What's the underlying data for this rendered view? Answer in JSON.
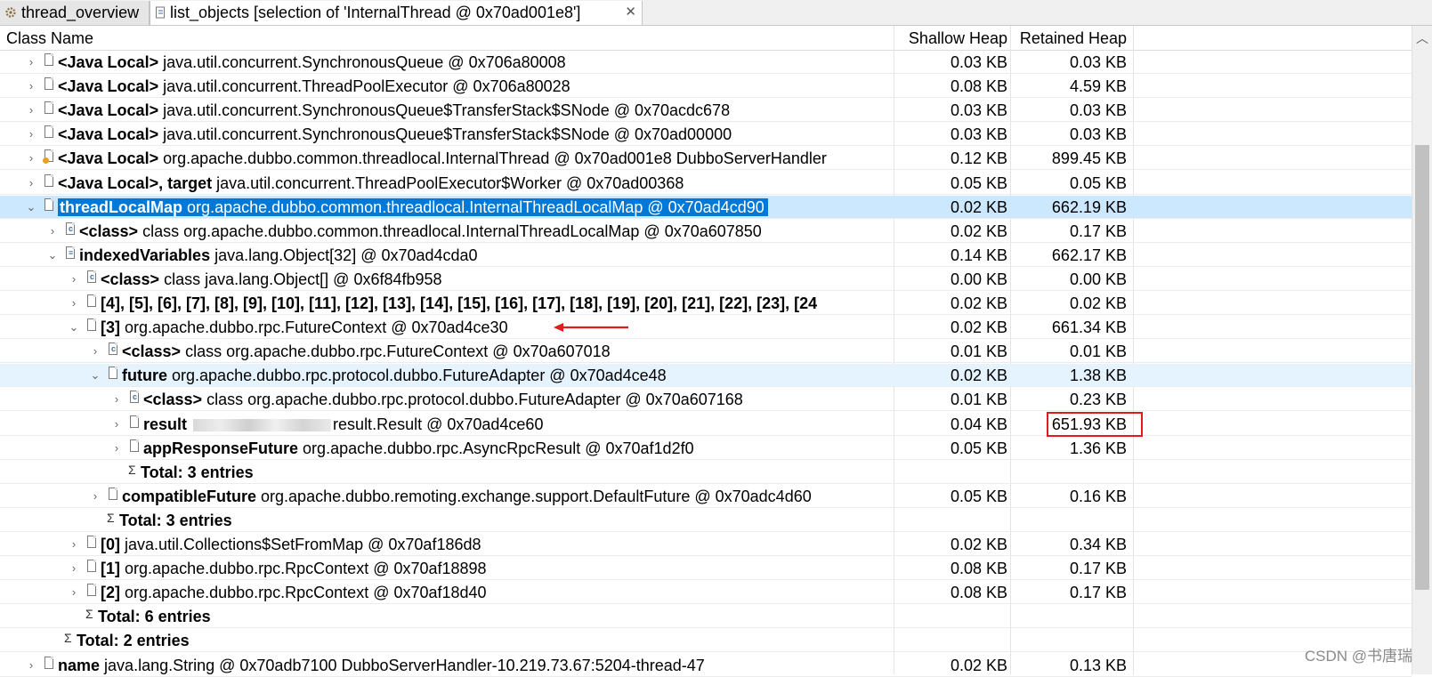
{
  "tabs": [
    {
      "label": "thread_overview",
      "icon": "gear-icon"
    },
    {
      "label": "list_objects  [selection of 'InternalThread @ 0x70ad001e8']",
      "icon": "list-objects-icon",
      "close": "✕"
    }
  ],
  "columns": {
    "name": "Class Name",
    "shallow": "Shallow Heap",
    "retained": "Retained Heap"
  },
  "rows": [
    {
      "depth": 0,
      "toggle": "›",
      "label": "<Java Local>",
      "detail": "java.util.concurrent.SynchronousQueue @ 0x706a80008",
      "shallow": "0.03 KB",
      "retained": "0.03 KB"
    },
    {
      "depth": 0,
      "toggle": "›",
      "label": "<Java Local>",
      "detail": "java.util.concurrent.ThreadPoolExecutor @ 0x706a80028",
      "shallow": "0.08 KB",
      "retained": "4.59 KB"
    },
    {
      "depth": 0,
      "toggle": "›",
      "label": "<Java Local>",
      "detail": "java.util.concurrent.SynchronousQueue$TransferStack$SNode @ 0x70acdc678",
      "shallow": "0.03 KB",
      "retained": "0.03 KB"
    },
    {
      "depth": 0,
      "toggle": "›",
      "label": "<Java Local>",
      "detail": "java.util.concurrent.SynchronousQueue$TransferStack$SNode @ 0x70ad00000",
      "shallow": "0.03 KB",
      "retained": "0.03 KB"
    },
    {
      "depth": 0,
      "toggle": "›",
      "label": "<Java Local>",
      "detail": "org.apache.dubbo.common.threadlocal.InternalThread @ 0x70ad001e8  DubboServerHandler",
      "shallow": "0.12 KB",
      "retained": "899.45 KB",
      "thread": true
    },
    {
      "depth": 0,
      "toggle": "›",
      "label": "<Java Local>, target",
      "detail": "java.util.concurrent.ThreadPoolExecutor$Worker @ 0x70ad00368",
      "shallow": "0.05 KB",
      "retained": "0.05 KB"
    },
    {
      "depth": 0,
      "toggle": "⌄",
      "label": "threadLocalMap",
      "detail": "org.apache.dubbo.common.threadlocal.InternalThreadLocalMap @ 0x70ad4cd90",
      "shallow": "0.02 KB",
      "retained": "662.19 KB",
      "selected": true
    },
    {
      "depth": 1,
      "toggle": "›",
      "label": "<class>",
      "detail": "class org.apache.dubbo.common.threadlocal.InternalThreadLocalMap @ 0x70a607850",
      "shallow": "0.02 KB",
      "retained": "0.17 KB",
      "cls": true
    },
    {
      "depth": 1,
      "toggle": "⌄",
      "label": "indexedVariables",
      "detail": "java.lang.Object[32] @ 0x70ad4cda0",
      "shallow": "0.14 KB",
      "retained": "662.17 KB",
      "arr": true
    },
    {
      "depth": 2,
      "toggle": "›",
      "label": "<class>",
      "detail": "class java.lang.Object[] @ 0x6f84fb958",
      "shallow": "0.00 KB",
      "retained": "0.00 KB",
      "cls": true
    },
    {
      "depth": 2,
      "toggle": "›",
      "label": "[4], [5], [6], [7], [8], [9], [10], [11], [12], [13], [14], [15], [16], [17], [18], [19], [20], [21], [22], [23], [24",
      "detail": "",
      "shallow": "0.02 KB",
      "retained": "0.02 KB"
    },
    {
      "depth": 2,
      "toggle": "⌄",
      "label": "[3]",
      "detail": "org.apache.dubbo.rpc.FutureContext @ 0x70ad4ce30",
      "shallow": "0.02 KB",
      "retained": "661.34 KB",
      "arrow": true
    },
    {
      "depth": 3,
      "toggle": "›",
      "label": "<class>",
      "detail": "class org.apache.dubbo.rpc.FutureContext @ 0x70a607018",
      "shallow": "0.01 KB",
      "retained": "0.01 KB",
      "cls": true
    },
    {
      "depth": 3,
      "toggle": "⌄",
      "label": "future",
      "detail": "org.apache.dubbo.rpc.protocol.dubbo.FutureAdapter @ 0x70ad4ce48",
      "shallow": "0.02 KB",
      "retained": "1.38 KB",
      "hover": true
    },
    {
      "depth": 4,
      "toggle": "›",
      "label": "<class>",
      "detail": "class org.apache.dubbo.rpc.protocol.dubbo.FutureAdapter @ 0x70a607168",
      "shallow": "0.01 KB",
      "retained": "0.23 KB",
      "cls": true
    },
    {
      "depth": 4,
      "toggle": "›",
      "label": "result",
      "detail": "result.Result @ 0x70ad4ce60",
      "shallow": "0.04 KB",
      "retained": "651.93 KB",
      "blurred": true,
      "boxed": true
    },
    {
      "depth": 4,
      "toggle": "›",
      "label": "appResponseFuture",
      "detail": "org.apache.dubbo.rpc.AsyncRpcResult @ 0x70af1d2f0",
      "shallow": "0.05 KB",
      "retained": "1.36 KB"
    },
    {
      "depth": 4,
      "toggle": "",
      "label": "Total: 3 entries",
      "detail": "",
      "shallow": "",
      "retained": "",
      "sum": true
    },
    {
      "depth": 3,
      "toggle": "›",
      "label": "compatibleFuture",
      "detail": "org.apache.dubbo.remoting.exchange.support.DefaultFuture @ 0x70adc4d60",
      "shallow": "0.05 KB",
      "retained": "0.16 KB"
    },
    {
      "depth": 3,
      "toggle": "",
      "label": "Total: 3 entries",
      "detail": "",
      "shallow": "",
      "retained": "",
      "sum": true
    },
    {
      "depth": 2,
      "toggle": "›",
      "label": "[0]",
      "detail": "java.util.Collections$SetFromMap @ 0x70af186d8",
      "shallow": "0.02 KB",
      "retained": "0.34 KB"
    },
    {
      "depth": 2,
      "toggle": "›",
      "label": "[1]",
      "detail": "org.apache.dubbo.rpc.RpcContext @ 0x70af18898",
      "shallow": "0.08 KB",
      "retained": "0.17 KB"
    },
    {
      "depth": 2,
      "toggle": "›",
      "label": "[2]",
      "detail": "org.apache.dubbo.rpc.RpcContext @ 0x70af18d40",
      "shallow": "0.08 KB",
      "retained": "0.17 KB"
    },
    {
      "depth": 2,
      "toggle": "",
      "label": "Total: 6 entries",
      "detail": "",
      "shallow": "",
      "retained": "",
      "sum": true
    },
    {
      "depth": 1,
      "toggle": "",
      "label": "Total: 2 entries",
      "detail": "",
      "shallow": "",
      "retained": "",
      "sum": true
    },
    {
      "depth": 0,
      "toggle": "›",
      "label": "name",
      "detail": "java.lang.String @ 0x70adb7100  DubboServerHandler-10.219.73.67:5204-thread-47",
      "shallow": "0.02 KB",
      "retained": "0.13 KB"
    }
  ],
  "watermark": "CSDN @书唐瑞",
  "colors": {
    "selection": "#0078d7",
    "highlight_box": "#e01b1b",
    "arrow": "#e01b1b",
    "hover_row": "#e5f3ff"
  }
}
